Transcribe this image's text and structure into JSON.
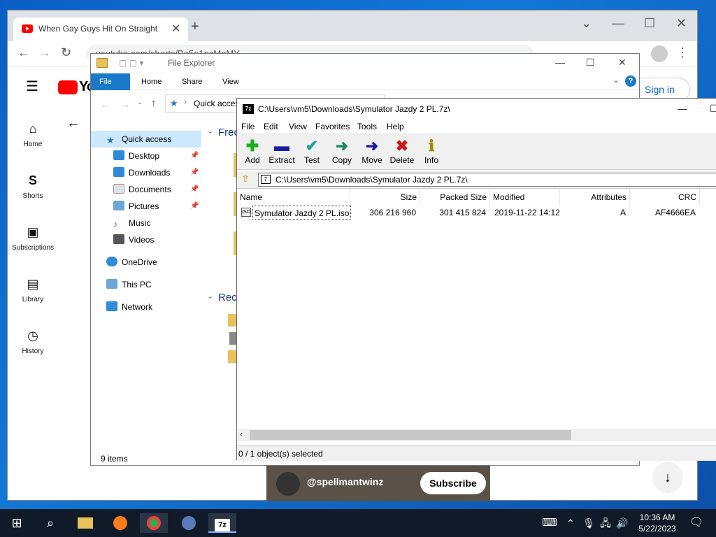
{
  "chrome": {
    "tab_title": "When Gay Guys Hit On Straight",
    "url": "youtube.com/shorts/Bo5e1pcMoMY",
    "new_tab": "+"
  },
  "youtube": {
    "logo": "Yo",
    "sidebar": [
      {
        "label": "Home",
        "icon": "home-icon"
      },
      {
        "label": "Shorts",
        "icon": "shorts-icon"
      },
      {
        "label": "Subscriptions",
        "icon": "subscriptions-icon"
      },
      {
        "label": "Library",
        "icon": "library-icon"
      },
      {
        "label": "History",
        "icon": "history-icon"
      }
    ],
    "signin": "Sign in",
    "handle": "@spellmantwinz",
    "subscribe": "Subscribe"
  },
  "explorer": {
    "title": "File Explorer",
    "ribbon": [
      "File",
      "Home",
      "Share",
      "View"
    ],
    "address": "Quick acces",
    "nav": {
      "quick_access": "Quick access",
      "items": [
        "Desktop",
        "Downloads",
        "Documents",
        "Pictures",
        "Music",
        "Videos"
      ],
      "onedrive": "OneDrive",
      "thispc": "This PC",
      "network": "Network"
    },
    "frequent": "Frec",
    "recent": "Rece",
    "status": "9 items"
  },
  "sevenzip": {
    "title": "C:\\Users\\vm5\\Downloads\\Symulator Jazdy 2 PL.7z\\",
    "menu": [
      "File",
      "Edit",
      "View",
      "Favorites",
      "Tools",
      "Help"
    ],
    "toolbar": [
      "Add",
      "Extract",
      "Test",
      "Copy",
      "Move",
      "Delete",
      "Info"
    ],
    "address": "C:\\Users\\vm5\\Downloads\\Symulator Jazdy 2 PL.7z\\",
    "columns": [
      "Name",
      "Size",
      "Packed Size",
      "Modified",
      "Attributes",
      "CRC"
    ],
    "rows": [
      {
        "name": "Symulator Jazdy 2 PL.iso",
        "size": "306 216 960",
        "packed": "301 415 824",
        "modified": "2019-11-22 14:12",
        "attributes": "A",
        "crc": "AF4666EA"
      }
    ],
    "status": "0 / 1 object(s) selected"
  },
  "taskbar": {
    "time": "10:36 AM",
    "date": "5/22/2023",
    "sevenzip_label": "7z"
  }
}
